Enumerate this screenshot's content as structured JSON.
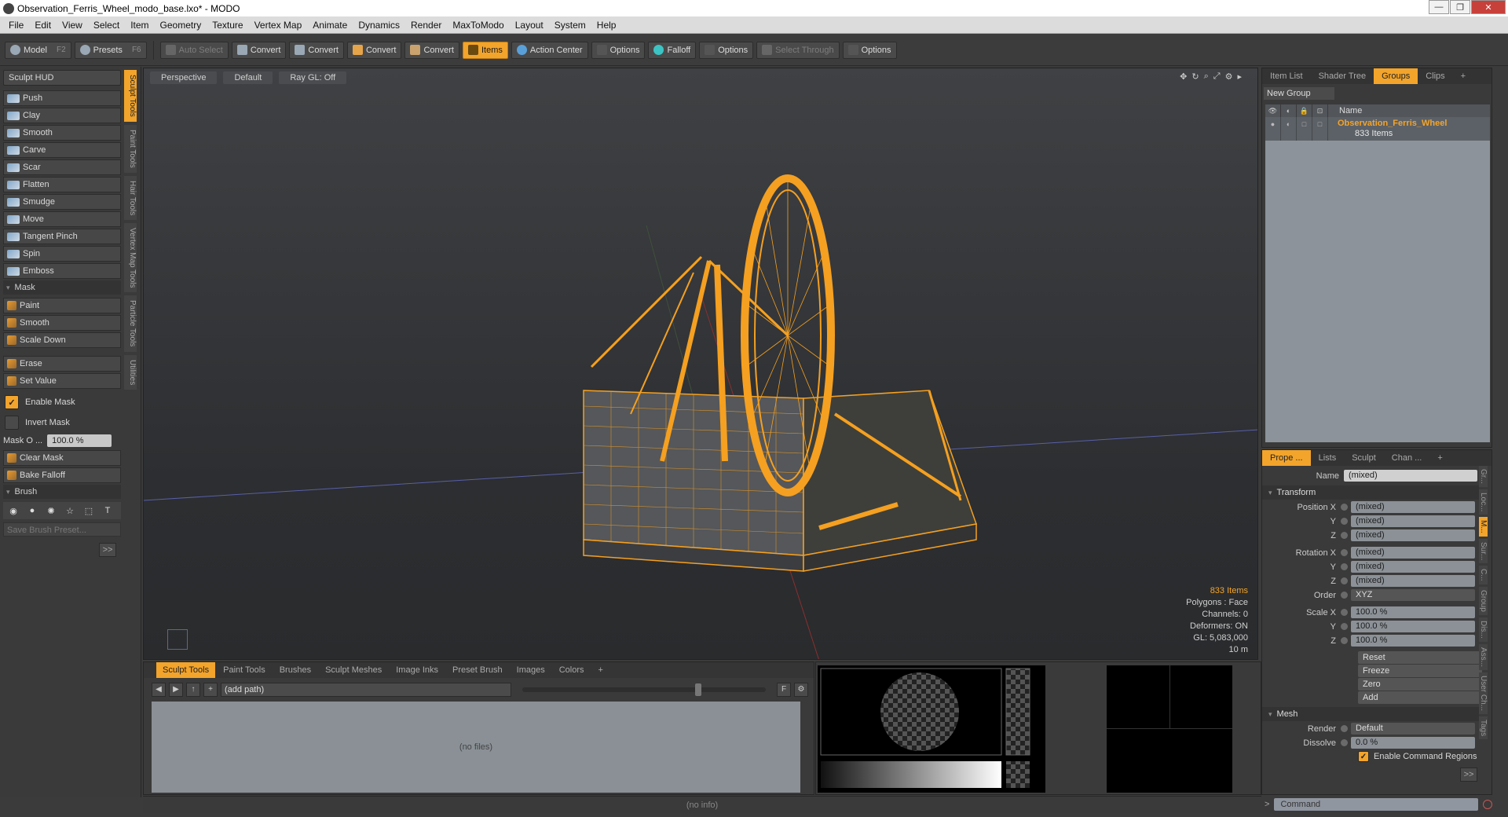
{
  "window": {
    "title": "Observation_Ferris_Wheel_modo_base.lxo* - MODO",
    "controls": [
      "—",
      "❐",
      "✕"
    ]
  },
  "menu": [
    "File",
    "Edit",
    "View",
    "Select",
    "Item",
    "Geometry",
    "Texture",
    "Vertex Map",
    "Animate",
    "Dynamics",
    "Render",
    "MaxToModo",
    "Layout",
    "System",
    "Help"
  ],
  "toolbar": {
    "model": "Model",
    "model_key": "F2",
    "presets": "Presets",
    "presets_key": "F6",
    "auto_select": "Auto Select",
    "convert": "Convert",
    "items": "Items",
    "action_center": "Action Center",
    "options": "Options",
    "falloff": "Falloff",
    "select_through": "Select Through"
  },
  "left": {
    "hud": "Sculpt HUD",
    "tools": [
      "Push",
      "Clay",
      "Smooth",
      "Carve",
      "Scar",
      "Flatten",
      "Smudge",
      "Move",
      "Tangent Pinch",
      "Spin",
      "Emboss"
    ],
    "mask_section": "Mask",
    "mask_tools": [
      "Paint",
      "Smooth",
      "Scale Down"
    ],
    "erase_tools": [
      "Erase",
      "Set Value"
    ],
    "enable_mask": "Enable Mask",
    "invert_mask": "Invert Mask",
    "mask_opacity_label": "Mask O ...",
    "mask_opacity_value": "100.0 %",
    "clear_tools": [
      "Clear Mask",
      "Bake Falloff"
    ],
    "brush_section": "Brush",
    "save_preset": "Save Brush Preset...",
    "more": ">>",
    "vtabs": [
      "Sculpt Tools",
      "Paint Tools",
      "Hair Tools",
      "Vertex Map Tools",
      "Particle Tools",
      "Utilities"
    ]
  },
  "viewport": {
    "view": "Perspective",
    "shading": "Default",
    "raygl": "Ray GL: Off",
    "stats": {
      "items": "833 Items",
      "polygons": "Polygons : Face",
      "channels": "Channels: 0",
      "deformers": "Deformers: ON",
      "gl": "GL: 5,083,000",
      "scale": "10 m"
    }
  },
  "bottom": {
    "tabs": [
      "Sculpt Tools",
      "Paint Tools",
      "Brushes",
      "Sculpt Meshes",
      "Image Inks",
      "Preset Brush",
      "Images",
      "Colors",
      "+"
    ],
    "path": "(add path)",
    "files": "(no files)",
    "status": "(no info)"
  },
  "right_top": {
    "tabs": [
      "Item List",
      "Shader Tree",
      "Groups",
      "Clips",
      "+"
    ],
    "new_group": "New Group",
    "name_col": "Name",
    "group_name": "Observation_Ferris_Wheel",
    "group_count": "833 Items"
  },
  "right_bottom": {
    "tabs": [
      "Prope ...",
      "Lists",
      "Sculpt",
      "Chan ...",
      "+"
    ],
    "name_label": "Name",
    "name_value": "(mixed)",
    "transform": "Transform",
    "position_label": "Position X",
    "rotation_label": "Rotation X",
    "y": "Y",
    "z": "Z",
    "mixed": "(mixed)",
    "order_label": "Order",
    "order_value": "XYZ",
    "scale_label": "Scale X",
    "scale_value": "100.0 %",
    "reset": "Reset",
    "freeze": "Freeze",
    "zero": "Zero",
    "add": "Add",
    "mesh": "Mesh",
    "render_label": "Render",
    "render_value": "Default",
    "dissolve_label": "Dissolve",
    "dissolve_value": "0.0 %",
    "enable_cmd": "Enable Command Regions",
    "more": ">>",
    "vtabs": [
      "Gr...",
      "Loc...",
      "M...",
      "Sur...",
      "C...",
      "Group",
      "Dis...",
      "Ass...",
      "User Ch...",
      "Tags"
    ]
  },
  "command": {
    "placeholder": "Command"
  },
  "colors": {
    "accent": "#f3a42b",
    "wire": "#f5a020"
  }
}
